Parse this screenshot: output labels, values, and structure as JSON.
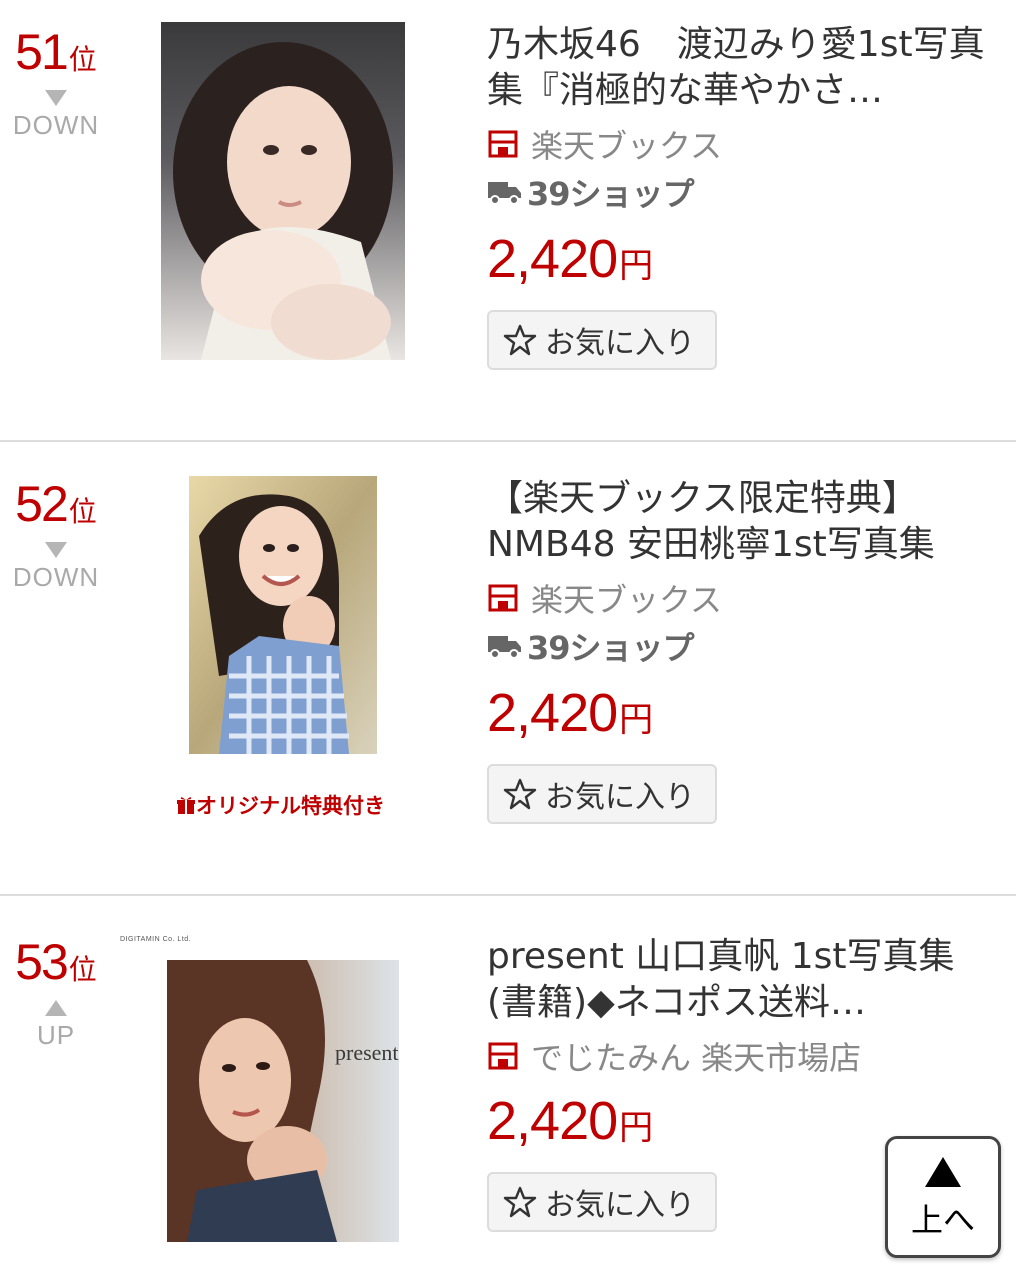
{
  "colors": {
    "accent": "#bf0000",
    "muted": "#a9a9a9",
    "divider": "#dddddd"
  },
  "items": [
    {
      "rank": "51",
      "rank_suffix": "位",
      "trend": "DOWN",
      "trend_icon": "down-triangle-icon",
      "title": "乃木坂46　渡辺みり愛1st写真集『消極的な華やかさ…",
      "shop": "楽天ブックス",
      "shipping": "39ショップ",
      "price": "2,420",
      "price_unit": "円",
      "favorite_label": "お気に入り"
    },
    {
      "rank": "52",
      "rank_suffix": "位",
      "trend": "DOWN",
      "trend_icon": "down-triangle-icon",
      "title": "【楽天ブックス限定特典】NMB48 安田桃寧1st写真集",
      "badge": "オリジナル特典付き",
      "shop": "楽天ブックス",
      "shipping": "39ショップ",
      "price": "2,420",
      "price_unit": "円",
      "favorite_label": "お気に入り"
    },
    {
      "rank": "53",
      "rank_suffix": "位",
      "trend": "UP",
      "trend_icon": "up-triangle-icon",
      "title": "present 山口真帆 1st写真集(書籍)◆ネコポス送料…",
      "cover_text": "present",
      "publisher_credit": "DIGITAMIN Co. Ltd.",
      "shop": "でじたみん 楽天市場店",
      "price": "2,420",
      "price_unit": "円",
      "favorite_label": "お気に入り"
    }
  ],
  "back_to_top": {
    "label": "上へ"
  }
}
